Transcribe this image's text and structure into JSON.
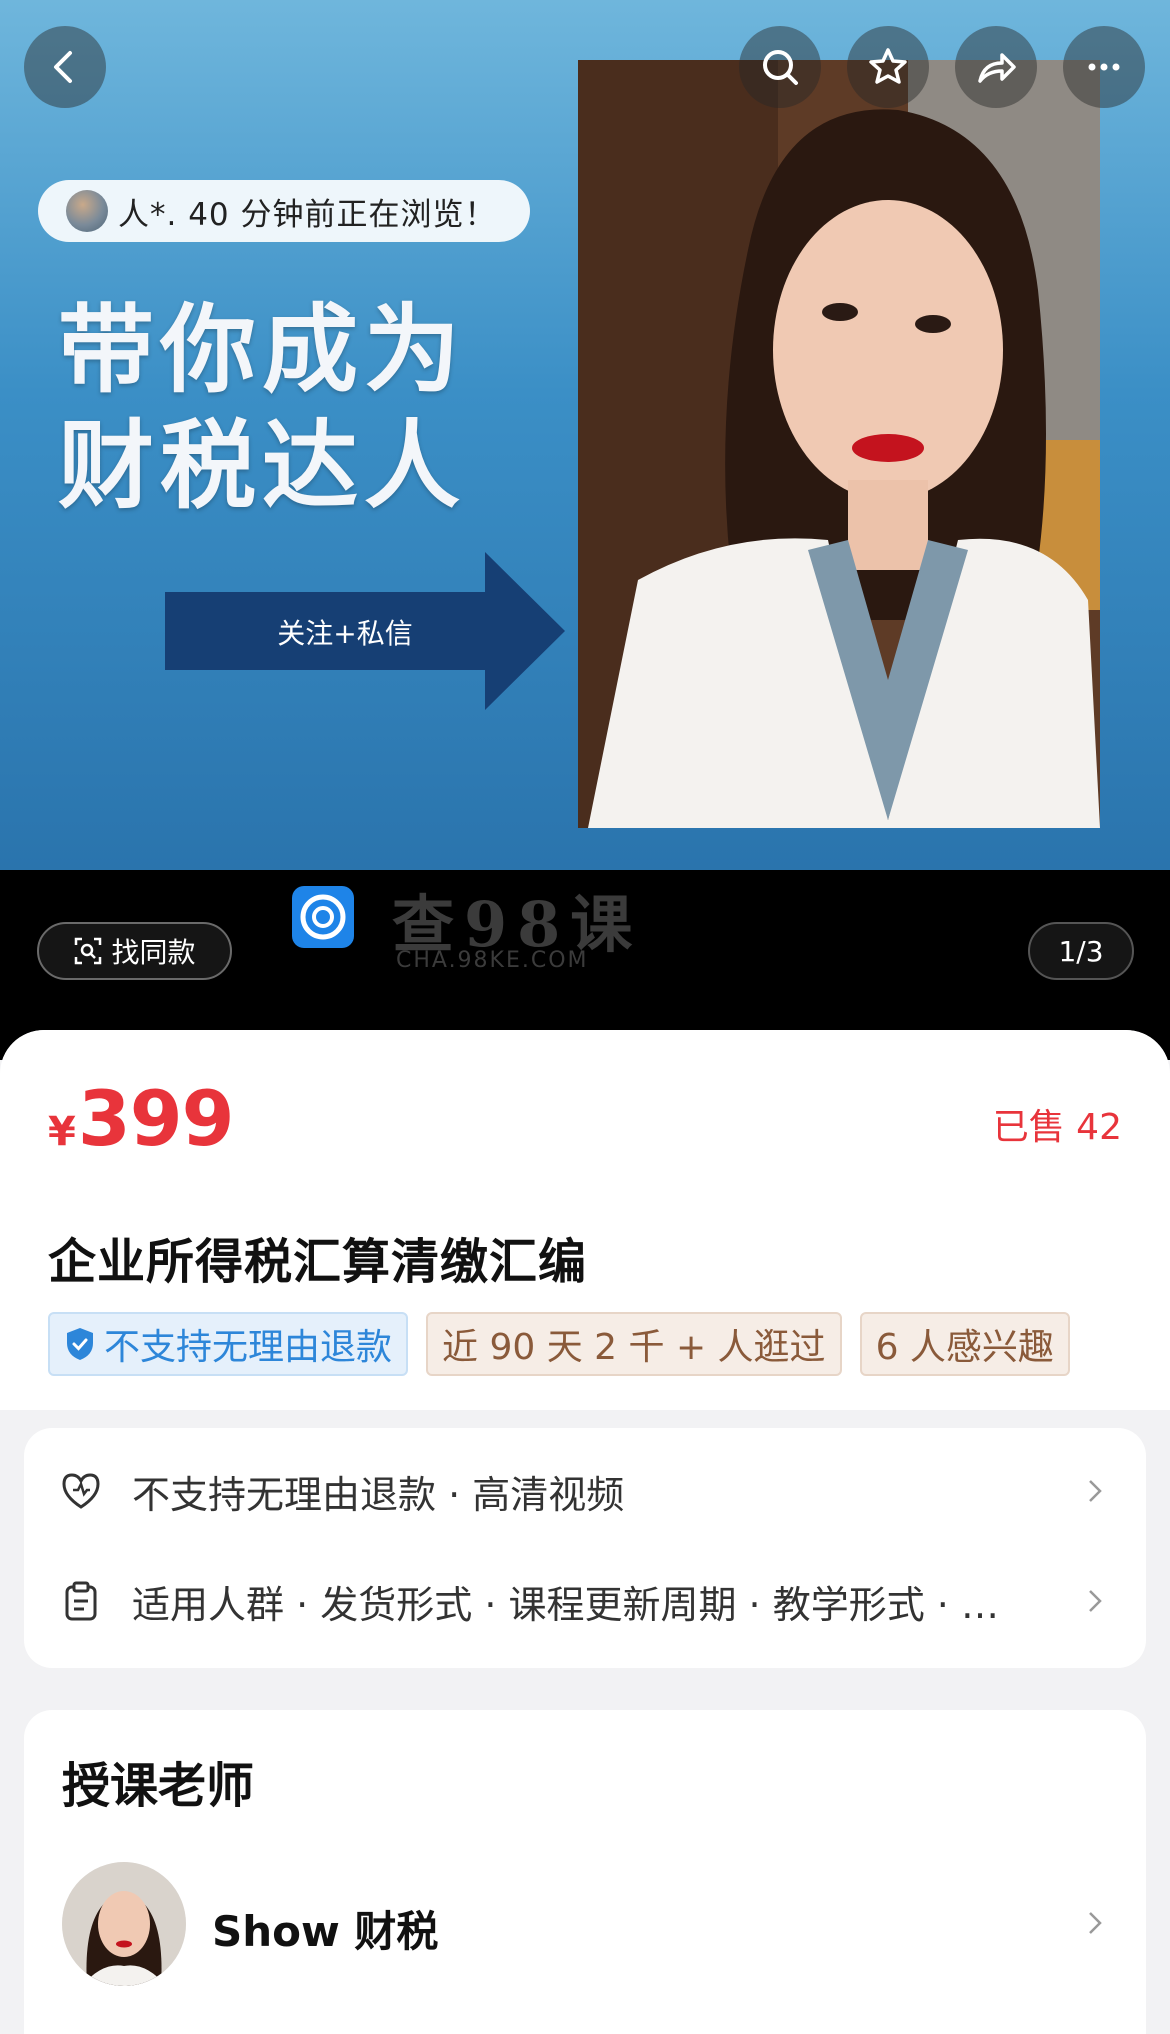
{
  "hero": {
    "viewer_text": "人*. 40 分钟前正在浏览！",
    "headline_line1": "带你成为",
    "headline_line2": "财税达人",
    "arrow_text": "关注+私信",
    "find_same_label": "找同款",
    "page_indicator": "1/3",
    "watermark_name": "查98课",
    "watermark_url": "CHA.98KE.COM"
  },
  "top_buttons": [
    "back-icon",
    "search-icon",
    "star-icon",
    "share-icon",
    "more-icon"
  ],
  "product": {
    "currency": "¥",
    "price": "399",
    "sold": "已售 42",
    "title": "企业所得税汇算清缴汇编",
    "tags": [
      "不支持无理由退款",
      "近 90 天 2 千 + 人逛过",
      "6 人感兴趣"
    ]
  },
  "info": {
    "row1": "不支持无理由退款 · 高清视频",
    "row2": "适用人群 · 发货形式 · 课程更新周期 · 教学形式 · …"
  },
  "teacher": {
    "heading": "授课老师",
    "name": "Show 财税"
  },
  "colors": {
    "accent_red": "#e8343b",
    "tag_blue": "#2d86d9",
    "tag_brown": "#8a5a3a"
  }
}
